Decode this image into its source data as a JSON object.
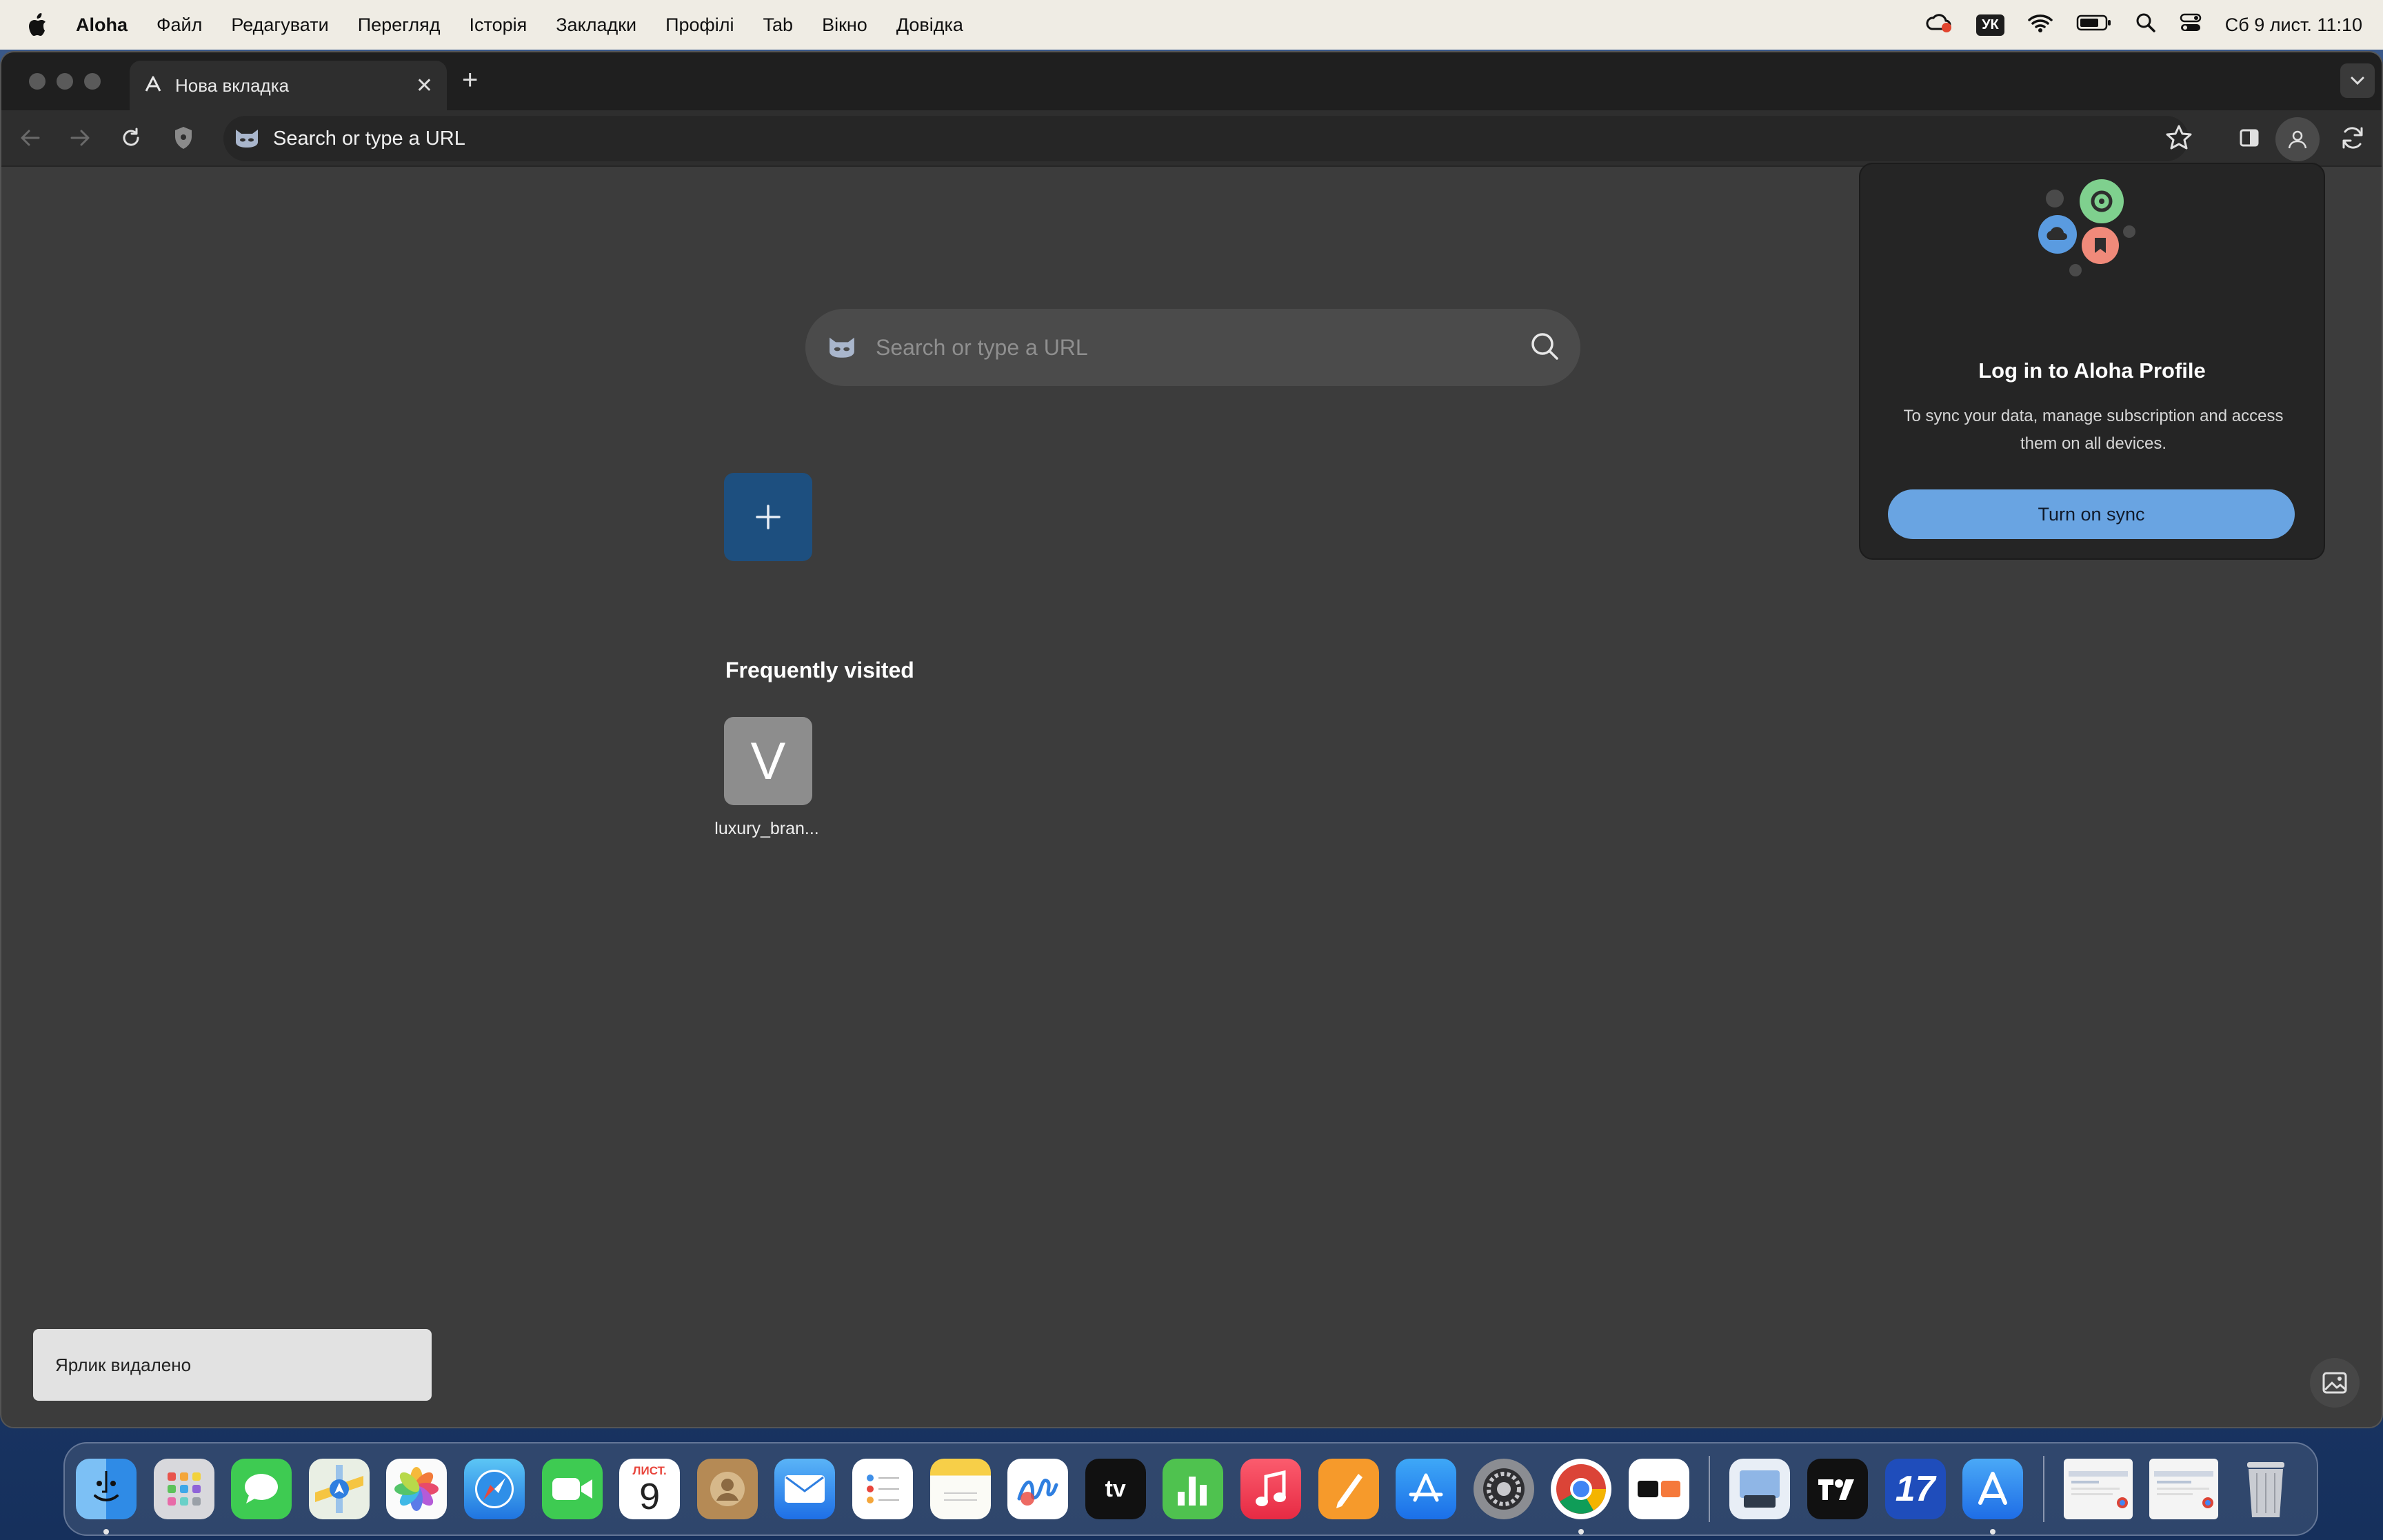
{
  "menubar": {
    "app_name": "Aloha",
    "items": [
      "Файл",
      "Редагувати",
      "Перегляд",
      "Історія",
      "Закладки",
      "Профілі",
      "Tab",
      "Вікно",
      "Довідка"
    ],
    "keyboard_layout": "УК",
    "clock": "Сб 9 лист.  11:10"
  },
  "tab": {
    "title": "Нова вкладка",
    "close_glyph": "✕",
    "new_tab_glyph": "+"
  },
  "toolbar": {
    "omnibox_placeholder": "Search or type a URL"
  },
  "ntp": {
    "search_placeholder": "Search or type a URL",
    "add_glyph": "+",
    "frequently_visited_title": "Frequently visited",
    "tiles": [
      {
        "letter": "V",
        "label": "luxury_bran..."
      }
    ]
  },
  "popup": {
    "title": "Log in to Aloha Profile",
    "description": "To sync your data, manage subscription and access them on all devices.",
    "button_label": "Turn on sync"
  },
  "snackbar": {
    "message": "Ярлик видалено"
  },
  "dock": {
    "calendar_month": "ЛИСТ.",
    "calendar_day": "9",
    "tv_label": "tv",
    "app_17_label": "17"
  },
  "colors": {
    "accent_blue": "#69a4e2",
    "add_tile": "#1d4f7f",
    "window_bg": "#3c3c3c"
  }
}
